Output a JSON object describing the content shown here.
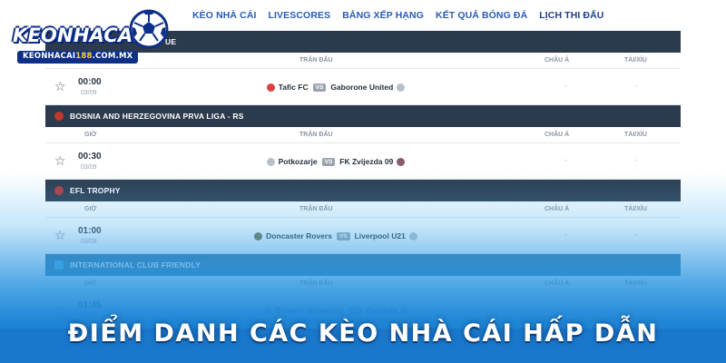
{
  "logo": {
    "brand": "KEONHACAI",
    "sub_prefix": "KEONHACAI",
    "sub_accent": "188",
    "sub_suffix": ".COM.MX"
  },
  "nav": {
    "items": [
      "KÈO NHÀ CÁI",
      "LIVESCORES",
      "BẢNG XẾP HẠNG",
      "KẾT QUẢ BÓNG ĐÁ",
      "LỊCH THI ĐẤU"
    ],
    "active_index": 4
  },
  "columns": {
    "time": "GIỜ",
    "match": "TRẬN ĐẤU",
    "asia": "CHÂU Á",
    "over_under": "TÀI/XỈU"
  },
  "leagues": [
    {
      "name": "UE",
      "flag_color": "#2b3a4d",
      "matches": [
        {
          "time": "00:00",
          "date": "03/09",
          "home": "Tafic FC",
          "away": "Gaborone United",
          "vs": "VS",
          "asia": "-",
          "ou": "-",
          "home_crest": "#d94040",
          "away_crest": "#b9bfc8"
        }
      ]
    },
    {
      "name": "BOSNIA AND HERZEGOVINA PRVA LIGA - RS",
      "flag_color": "#c0392b",
      "matches": [
        {
          "time": "00:30",
          "date": "03/09",
          "home": "Potkozarje",
          "away": "FK Zvijezda 09",
          "vs": "VS",
          "asia": "-",
          "ou": "-",
          "home_crest": "#b9bfc8",
          "away_crest": "#8a5a6e"
        }
      ]
    },
    {
      "name": "EFL TROPHY",
      "flag_color": "#b03a3a",
      "matches": [
        {
          "time": "01:00",
          "date": "03/09",
          "home": "Doncaster Rovers",
          "away": "Liverpool U21",
          "vs": "VS",
          "asia": "-",
          "ou": "-",
          "home_crest": "#6b6a3f",
          "away_crest": "#b9bfc8"
        }
      ]
    },
    {
      "name": "INTERNATIONAL CLUB FRIENDLY",
      "flag_color": "#3fa9e0",
      "matches": [
        {
          "time": "01:45",
          "date": "03/09",
          "home": "Queen's University",
          "away": "Dundela",
          "vs": "VS",
          "asia": "-",
          "ou": "-",
          "home_crest": "#b9bfc8",
          "away_crest": "#b9bfc8"
        }
      ]
    }
  ],
  "banner": {
    "caption": "ĐIỂM DANH CÁC KÈO NHÀ CÁI HẤP DẪN"
  },
  "colors": {
    "nav_text": "#2a5bb6",
    "league_bar": "#2b3a4d",
    "banner_blue": "#1a7dcf"
  }
}
